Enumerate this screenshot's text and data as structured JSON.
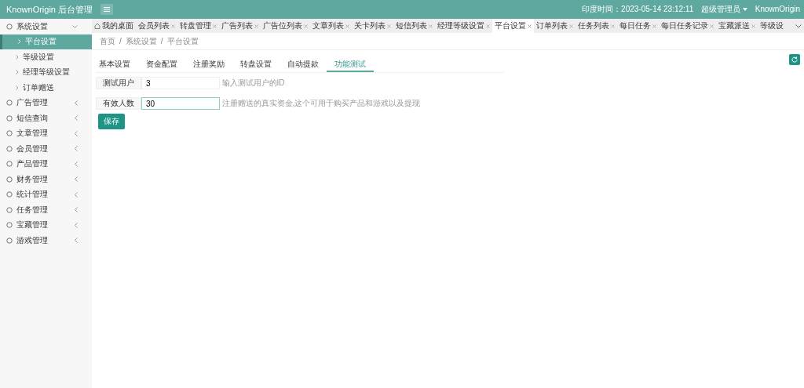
{
  "header": {
    "brand": "KnownOrigin 后台管理",
    "time": "印度时间：2023-05-14 23:12:11",
    "user": "超级管理员",
    "site": "KnownOrigin"
  },
  "sidebar": {
    "items": [
      {
        "label": "系统设置",
        "expanded": true,
        "children": [
          {
            "label": "平台设置",
            "selected": true
          },
          {
            "label": "等级设置",
            "selected": false
          },
          {
            "label": "经理等级设置",
            "selected": false
          },
          {
            "label": "订单赠送",
            "selected": false
          }
        ]
      },
      {
        "label": "广告管理",
        "expanded": false
      },
      {
        "label": "短信查询",
        "expanded": false
      },
      {
        "label": "文章管理",
        "expanded": false
      },
      {
        "label": "会员管理",
        "expanded": false
      },
      {
        "label": "产品管理",
        "expanded": false
      },
      {
        "label": "财务管理",
        "expanded": false
      },
      {
        "label": "统计管理",
        "expanded": false
      },
      {
        "label": "任务管理",
        "expanded": false
      },
      {
        "label": "宝藏管理",
        "expanded": false
      },
      {
        "label": "游戏管理",
        "expanded": false
      }
    ]
  },
  "tabs": [
    {
      "label": "我的桌面",
      "kind": "home",
      "selected": false
    },
    {
      "label": "会员列表",
      "kind": "page",
      "selected": false
    },
    {
      "label": "转盘管理",
      "kind": "page",
      "selected": false
    },
    {
      "label": "广告列表",
      "kind": "page",
      "selected": false
    },
    {
      "label": "广告位列表",
      "kind": "page",
      "selected": false
    },
    {
      "label": "文章列表",
      "kind": "page",
      "selected": false
    },
    {
      "label": "关卡列表",
      "kind": "page",
      "selected": false
    },
    {
      "label": "短信列表",
      "kind": "page",
      "selected": false
    },
    {
      "label": "经理等级设置",
      "kind": "page",
      "selected": false
    },
    {
      "label": "平台设置",
      "kind": "page",
      "selected": true
    },
    {
      "label": "订单列表",
      "kind": "page",
      "selected": false
    },
    {
      "label": "任务列表",
      "kind": "page",
      "selected": false
    },
    {
      "label": "每日任务",
      "kind": "page",
      "selected": false
    },
    {
      "label": "每日任务记录",
      "kind": "page",
      "selected": false
    },
    {
      "label": "宝藏派送",
      "kind": "page",
      "selected": false
    },
    {
      "label": "等级设",
      "kind": "cut",
      "selected": false
    }
  ],
  "breadcrumb": [
    "首页",
    "系统设置",
    "平台设置"
  ],
  "breadcrumb_separator": "/",
  "settings_tabs": [
    {
      "label": "基本设置",
      "selected": false
    },
    {
      "label": "资金配置",
      "selected": false
    },
    {
      "label": "注册奖励",
      "selected": false
    },
    {
      "label": "转盘设置",
      "selected": false
    },
    {
      "label": "自动提款",
      "selected": false
    },
    {
      "label": "功能测试",
      "selected": true
    }
  ],
  "form": [
    {
      "label": "测试用户",
      "value": "3",
      "hint": "输入测试用户的ID",
      "focused": false
    },
    {
      "label": "有效人数",
      "value": "30",
      "hint": "注册赠送的真实资金,这个可用于购买产品和游戏以及提现",
      "focused": true
    }
  ],
  "save_button": "保存"
}
